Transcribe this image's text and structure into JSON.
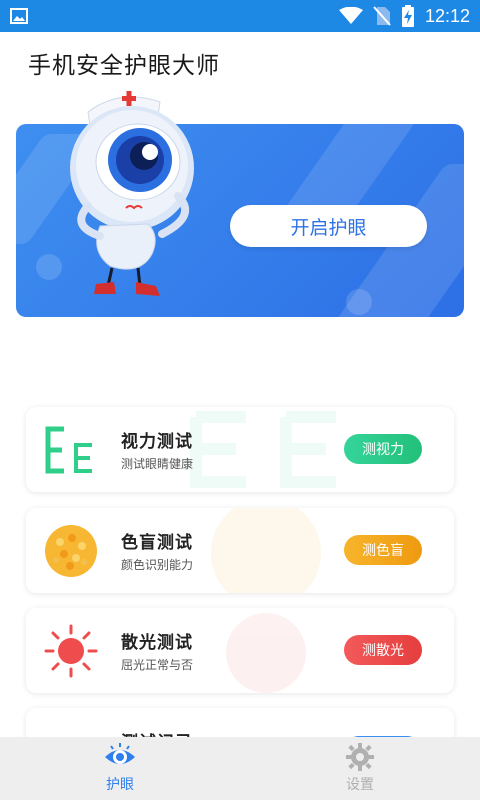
{
  "status_bar": {
    "time": "12:12"
  },
  "app": {
    "title": "手机安全护眼大师"
  },
  "hero": {
    "button_label": "开启护眼"
  },
  "cards": [
    {
      "title": "视力测试",
      "subtitle": "测试眼睛健康",
      "button": "测视力",
      "button_color": "#2fcf8a"
    },
    {
      "title": "色盲测试",
      "subtitle": "颜色识别能力",
      "button": "测色盲",
      "button_color": "#f3a41d"
    },
    {
      "title": "散光测试",
      "subtitle": "屈光正常与否",
      "button": "测散光",
      "button_color": "#ef4d4d"
    },
    {
      "title": "测试记录",
      "subtitle": "",
      "button": "",
      "button_color": "#3a8ff0"
    }
  ],
  "bottom_nav": [
    {
      "label": "护眼",
      "active": true,
      "color": "#2f80ed"
    },
    {
      "label": "设置",
      "active": false,
      "color": "#b0b0b0"
    }
  ]
}
